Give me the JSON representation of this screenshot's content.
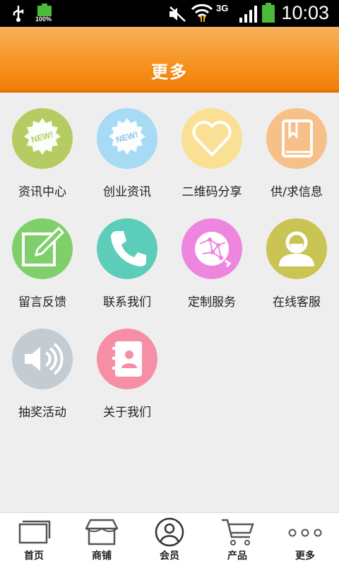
{
  "status_bar": {
    "time": "10:03",
    "battery_percent": "100%",
    "network": "3G",
    "icons": [
      "usb-icon",
      "battery-icon",
      "mute-icon",
      "wifi-icon",
      "signal-icon",
      "battery-icon"
    ]
  },
  "header": {
    "title": "更多"
  },
  "grid": {
    "items": [
      {
        "label": "资讯中心",
        "icon": "new-badge-icon",
        "color": "#b5cc62"
      },
      {
        "label": "创业资讯",
        "icon": "new-badge-icon",
        "color": "#a7daf5"
      },
      {
        "label": "二维码分享",
        "icon": "heart-icon",
        "color": "#f9e094"
      },
      {
        "label": "供/求信息",
        "icon": "book-icon",
        "color": "#f6c088"
      },
      {
        "label": "留言反馈",
        "icon": "edit-icon",
        "color": "#7fd06a"
      },
      {
        "label": "联系我们",
        "icon": "phone-icon",
        "color": "#5ccdb8"
      },
      {
        "label": "定制服务",
        "icon": "globe-icon",
        "color": "#ee86e0"
      },
      {
        "label": "在线客服",
        "icon": "user-icon",
        "color": "#c9c454"
      },
      {
        "label": "抽奖活动",
        "icon": "speaker-icon",
        "color": "#c3cbd3"
      },
      {
        "label": "关于我们",
        "icon": "contacts-icon",
        "color": "#f68fa5"
      }
    ],
    "badge_text": "NEW!"
  },
  "nav": {
    "items": [
      {
        "label": "首页",
        "icon": "home-icon"
      },
      {
        "label": "商铺",
        "icon": "shop-icon"
      },
      {
        "label": "会员",
        "icon": "member-icon"
      },
      {
        "label": "产品",
        "icon": "cart-icon"
      },
      {
        "label": "更多",
        "icon": "more-icon"
      }
    ]
  }
}
